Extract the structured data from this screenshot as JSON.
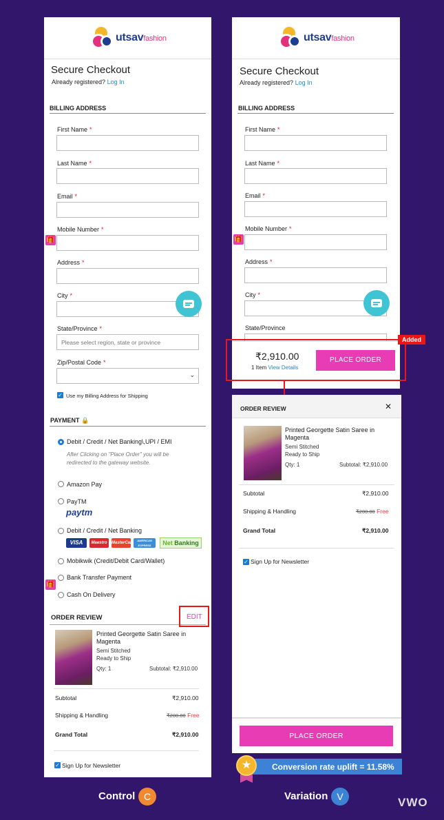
{
  "brand": {
    "name": "utsav",
    "name_suffix": "fashion"
  },
  "control": {
    "title": "Secure Checkout",
    "already_registered": "Already registered?",
    "login": "Log In",
    "billing_title": "BILLING ADDRESS",
    "fields": [
      {
        "label": "First Name",
        "value": ""
      },
      {
        "label": "Last Name",
        "value": ""
      },
      {
        "label": "Email",
        "value": ""
      },
      {
        "label": "Mobile Number",
        "value": ""
      },
      {
        "label": "Address",
        "value": ""
      },
      {
        "label": "City",
        "value": ""
      },
      {
        "label": "State/Province",
        "placeholder": "Please select region, state or province"
      },
      {
        "label": "Zip/Postal Code",
        "value": ""
      }
    ],
    "required_mark": "*",
    "use_billing": "Use my Billing Address for Shipping",
    "payment_title": "PAYMENT",
    "payment_options": [
      "Debit / Credit / Net Banking\\,UPI / EMI",
      "Amazon Pay",
      "PayTM",
      "Debit / Credit / Net Banking",
      "Mobikwik (Credit/Debit Card/Wallet)",
      "Bank Transfer Payment",
      "Cash On Delivery"
    ],
    "payment_note": "After Clicking on \"Place Order\" you will be redirected to the gateway website.",
    "paytm_logo": "paytm",
    "cards": [
      "VISA",
      "Maestro",
      "MasterCard",
      "AMERICAN EXPRESS"
    ],
    "netbanking": {
      "net": "Net",
      "banking": "Banking"
    },
    "order_review_title": "ORDER REVIEW",
    "edit": "EDIT",
    "product": {
      "name": "Printed Georgette Satin Saree in Magenta",
      "stitch": "Semi Stitched",
      "ship": "Ready to Ship",
      "qty": "Qty: 1",
      "subtotal": "Subtotal: ₹2,910.00"
    },
    "subtotal_label": "Subtotal",
    "subtotal_value": "₹2,910.00",
    "shipping_label": "Shipping & Handling",
    "shipping_old": "₹200.00",
    "shipping_free": "Free",
    "grand_label": "Grand Total",
    "grand_value": "₹2,910.00",
    "newsletter": "Sign Up for Newsletter"
  },
  "variation": {
    "title": "Secure Checkout",
    "already_registered": "Already registered?",
    "login": "Log In",
    "billing_title": "BILLING ADDRESS",
    "fields": [
      "First Name",
      "Last Name",
      "Email",
      "Mobile Number",
      "Address",
      "City",
      "State/Province"
    ],
    "sticky_price": "₹2,910.00",
    "sticky_items": "1 Item",
    "view_details": "View Details",
    "place_order": "PLACE ORDER",
    "added": "Added",
    "order_review_title": "ORDER REVIEW",
    "close": "✕",
    "product": {
      "name": "Printed Georgette Satin Saree in Magenta",
      "stitch": "Semi Stitched",
      "ship": "Ready to Ship",
      "qty": "Qty: 1",
      "subtotal": "Subtotal: ₹2,910.00"
    },
    "subtotal_label": "Subtotal",
    "subtotal_value": "₹2,910.00",
    "shipping_label": "Shipping & Handling",
    "shipping_old": "₹200.00",
    "shipping_free": "Free",
    "grand_label": "Grand Total",
    "grand_value": "₹2,910.00",
    "newsletter": "Sign Up for Newsletter",
    "bottom_place_order": "PLACE ORDER"
  },
  "labels": {
    "control": "Control",
    "control_badge": "C",
    "variation": "Variation",
    "variation_badge": "V"
  },
  "uplift": {
    "text": "Conversion rate uplift =  11.58%"
  },
  "vwo": "VWO",
  "colors": {
    "background": "#32166b",
    "accent": "#e83cb4",
    "highlight": "#e81818",
    "link": "#1a8bd6",
    "control_badge": "#f08a30",
    "variation_badge": "#3c83d6"
  }
}
